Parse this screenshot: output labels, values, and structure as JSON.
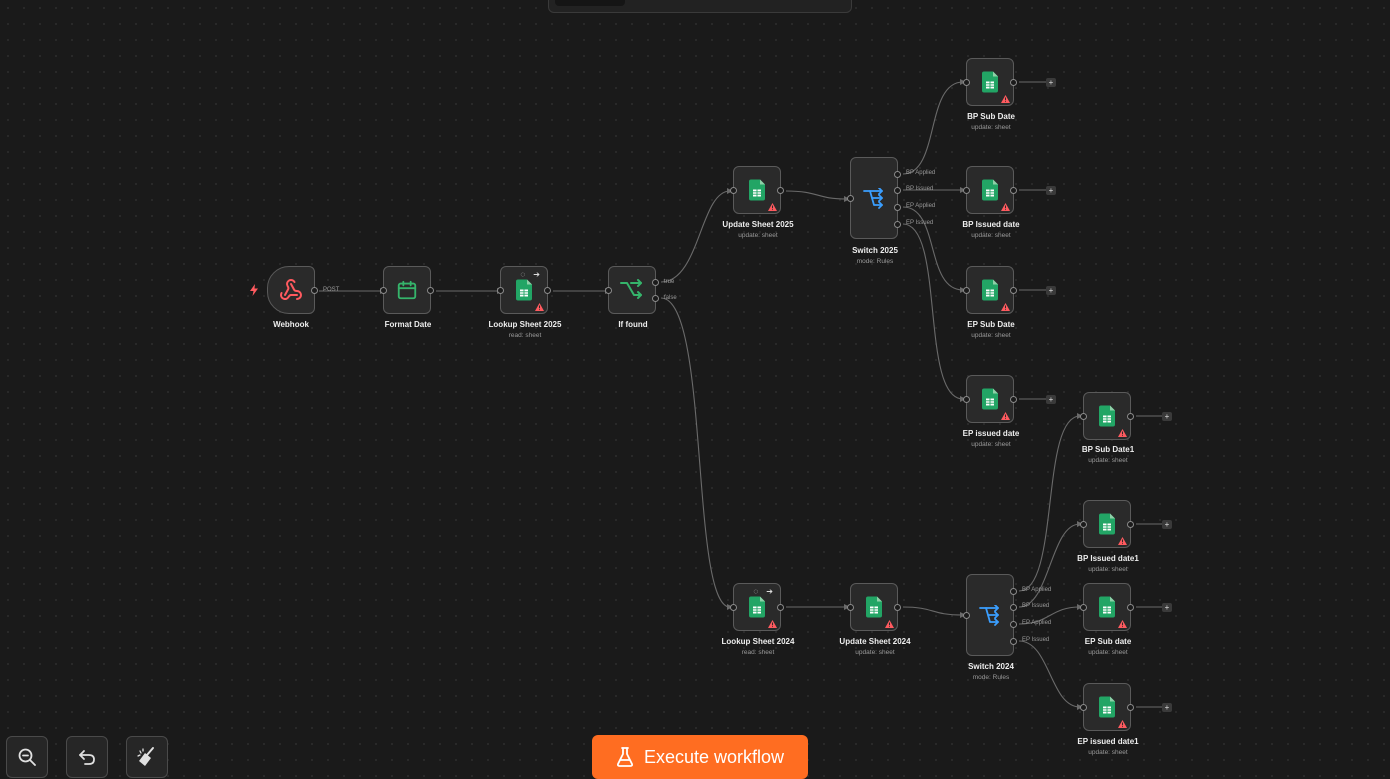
{
  "canvas": {
    "nodes": [
      {
        "id": "webhook",
        "label": "Webhook",
        "sublabel": "",
        "icon": "webhook-icon"
      },
      {
        "id": "format-date",
        "label": "Format Date",
        "sublabel": "",
        "icon": "calendar-icon"
      },
      {
        "id": "lookup-2025",
        "label": "Lookup Sheet 2025",
        "sublabel": "read: sheet",
        "icon": "google-sheets-icon"
      },
      {
        "id": "if-found",
        "label": "If found",
        "sublabel": "",
        "icon": "if-branch-icon"
      },
      {
        "id": "update-2025",
        "label": "Update Sheet 2025",
        "sublabel": "update: sheet",
        "icon": "google-sheets-icon"
      },
      {
        "id": "switch-2025",
        "label": "Switch 2025",
        "sublabel": "mode: Rules",
        "icon": "switch-icon"
      },
      {
        "id": "bp-sub-date",
        "label": "BP Sub Date",
        "sublabel": "update: sheet",
        "icon": "google-sheets-icon"
      },
      {
        "id": "bp-issued-date",
        "label": "BP Issued date",
        "sublabel": "update: sheet",
        "icon": "google-sheets-icon"
      },
      {
        "id": "ep-sub-date",
        "label": "EP Sub Date",
        "sublabel": "update: sheet",
        "icon": "google-sheets-icon"
      },
      {
        "id": "ep-issued-date",
        "label": "EP issued date",
        "sublabel": "update: sheet",
        "icon": "google-sheets-icon"
      },
      {
        "id": "lookup-2024",
        "label": "Lookup Sheet 2024",
        "sublabel": "read: sheet",
        "icon": "google-sheets-icon"
      },
      {
        "id": "update-2024",
        "label": "Update Sheet 2024",
        "sublabel": "update: sheet",
        "icon": "google-sheets-icon"
      },
      {
        "id": "switch-2024",
        "label": "Switch 2024",
        "sublabel": "mode: Rules",
        "icon": "switch-icon"
      },
      {
        "id": "bp-sub-date1",
        "label": "BP Sub Date1",
        "sublabel": "update: sheet",
        "icon": "google-sheets-icon"
      },
      {
        "id": "bp-issued-date1",
        "label": "BP Issued date1",
        "sublabel": "update: sheet",
        "icon": "google-sheets-icon"
      },
      {
        "id": "ep-sub-date-2",
        "label": "EP Sub date",
        "sublabel": "update: sheet",
        "icon": "google-sheets-icon"
      },
      {
        "id": "ep-issued-date1",
        "label": "EP issued date1",
        "sublabel": "update: sheet",
        "icon": "google-sheets-icon"
      }
    ],
    "output_labels": {
      "webhook_post": "POST",
      "if_true": "true",
      "if_false": "false",
      "switch_2025": [
        "BP Applied",
        "BP Issued",
        "EP Applied",
        "EP Issued"
      ],
      "switch_2024": [
        "BP Applied",
        "BP Issued",
        "EP Applied",
        "EP Issued"
      ]
    },
    "add_node_symbol": "+"
  },
  "toolbar": {
    "zoom_out_icon": "zoom-out-icon",
    "undo_icon": "undo-icon",
    "tidy_icon": "broom-icon"
  },
  "execute": {
    "label": "Execute workflow",
    "icon": "flask-icon",
    "color": "#ff6d21"
  },
  "colors": {
    "sheets_green": "#22a565",
    "webhook_red": "#ff5a5f",
    "if_green": "#35b46b",
    "switch_blue": "#3a9eff",
    "warning_red": "#ff5a5f"
  }
}
